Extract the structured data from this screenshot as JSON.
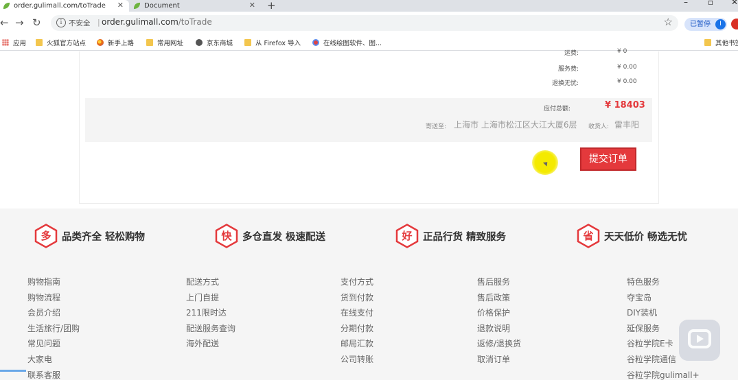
{
  "browser": {
    "tabs": [
      {
        "title": "order.gulimall.com/toTrade",
        "active": true
      },
      {
        "title": "Document",
        "active": false
      }
    ],
    "new_tab": "+",
    "window_controls": {
      "minimize": "–",
      "restore": "▫",
      "close": "✕"
    },
    "security_label": "不安全",
    "url_host": "order.gulimall.com",
    "url_path": "/toTrade",
    "paused_label": "已暂停",
    "avatar_letter": "I",
    "bookmarks": [
      {
        "label": "应用",
        "icon": "apps-icon"
      },
      {
        "label": "火狐官方站点",
        "icon": "folder-icon"
      },
      {
        "label": "新手上路",
        "icon": "firefox-icon"
      },
      {
        "label": "常用网址",
        "icon": "folder-icon"
      },
      {
        "label": "京东商城",
        "icon": "globe-icon"
      },
      {
        "label": "从 Firefox 导入",
        "icon": "folder-icon"
      },
      {
        "label": "在线绘图软件、图...",
        "icon": "draw-icon"
      },
      {
        "label": "其他书签",
        "icon": "folder-icon"
      }
    ]
  },
  "order": {
    "fees": [
      {
        "label": "运费:",
        "value": "¥ 0"
      },
      {
        "label": "服务费:",
        "value": "¥ 0.00"
      },
      {
        "label": "退换无忧:",
        "value": "¥ 0.00"
      }
    ],
    "total_label": "应付总额:",
    "total_value": "¥ 18403",
    "ship_label": "寄送至:",
    "ship_address": "上海市 上海市松江区大江大厦6层",
    "receiver_label": "收货人:",
    "receiver_name": "雷丰阳",
    "submit_label": "提交订单"
  },
  "footer": {
    "promises": [
      {
        "badge": "多",
        "text": "品类齐全  轻松购物"
      },
      {
        "badge": "快",
        "text": "多仓直发  极速配送"
      },
      {
        "badge": "好",
        "text": "正品行货  精致服务"
      },
      {
        "badge": "省",
        "text": "天天低价  畅选无忧"
      }
    ],
    "columns": [
      [
        "购物指南",
        "购物流程",
        "会员介绍",
        "生活旅行/团购",
        "常见问题",
        "大家电",
        "联系客服"
      ],
      [
        "配送方式",
        "上门自提",
        "211限时达",
        "配送服务查询",
        "海外配送"
      ],
      [
        "支付方式",
        "货到付款",
        "在线支付",
        "分期付款",
        "邮局汇款",
        "公司转账"
      ],
      [
        "售后服务",
        "售后政策",
        "价格保护",
        "退款说明",
        "返修/退换货",
        "取消订单"
      ],
      [
        "特色服务",
        "夺宝岛",
        "DIY装机",
        "延保服务",
        "谷粒学院E卡",
        "谷粒学院通信",
        "谷粒学院gulimall+"
      ]
    ]
  },
  "colors": {
    "accent": "#e4393c",
    "footer_bg": "#f5f5f5",
    "summary_bg": "#f4f4f4"
  }
}
